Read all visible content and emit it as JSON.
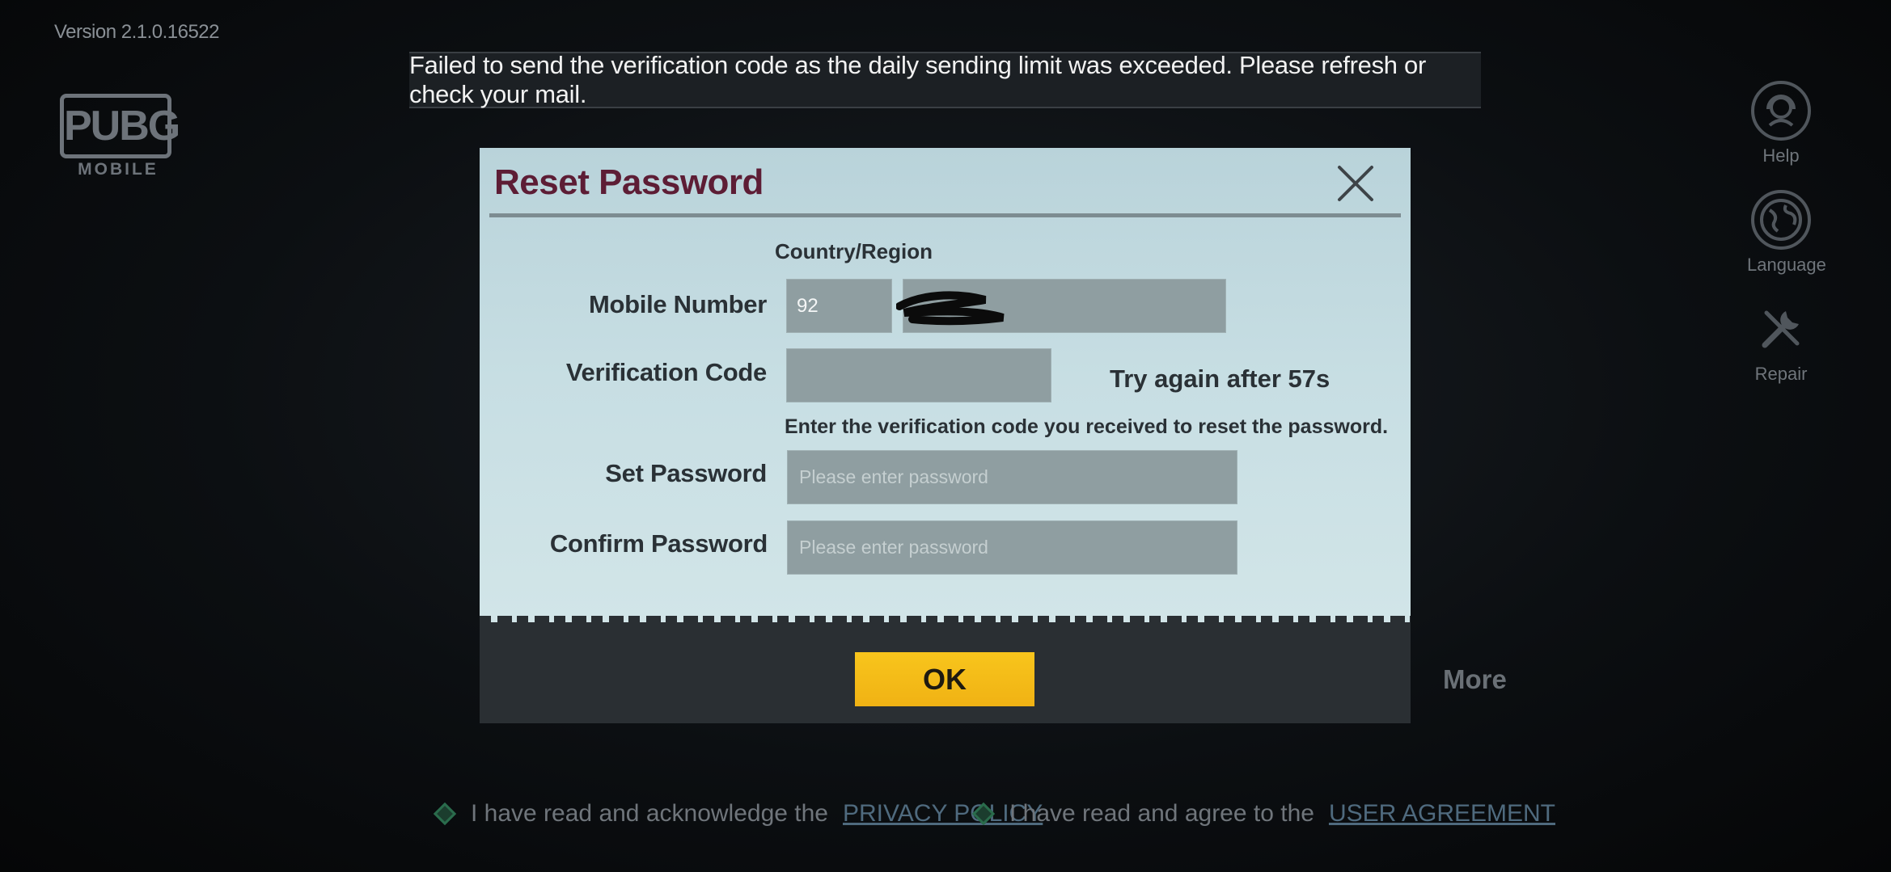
{
  "version": "Version 2.1.0.16522",
  "logo": {
    "main": "PUBG",
    "sub": "MOBILE"
  },
  "toast": "Failed to send the verification code as the daily sending limit was exceeded. Please refresh or check your mail.",
  "rail": {
    "help": "Help",
    "language": "Language",
    "repair": "Repair",
    "more": "More"
  },
  "dialog": {
    "title": "Reset Password",
    "country_region_label": "Country/Region",
    "mobile_label": "Mobile Number",
    "country_code": "92",
    "verification_label": "Verification Code",
    "countdown": "Try again after 57s",
    "hint": "Enter the verification code you received to reset the password.",
    "set_password_label": "Set Password",
    "set_password_placeholder": "Please enter password",
    "confirm_password_label": "Confirm Password",
    "confirm_password_placeholder": "Please enter password",
    "ok_label": "OK"
  },
  "agreements": {
    "privacy_text": "I have read and acknowledge the",
    "privacy_link": "PRIVACY POLICY",
    "user_text": "I have read and agree to the",
    "user_link": "USER AGREEMENT"
  },
  "colors": {
    "title": "#5d1d35",
    "ok_button": "#f8c51c",
    "checkbox": "#2a6c4c",
    "dialog_bg": "#c7dee3"
  }
}
